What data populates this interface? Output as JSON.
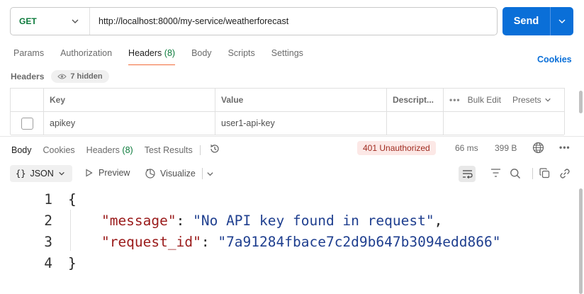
{
  "request": {
    "method": "GET",
    "url": "http://localhost:8000/my-service/weatherforecast",
    "send_label": "Send"
  },
  "request_tabs": [
    {
      "label": "Params",
      "count": ""
    },
    {
      "label": "Authorization",
      "count": ""
    },
    {
      "label": "Headers",
      "count": "(8)"
    },
    {
      "label": "Body",
      "count": ""
    },
    {
      "label": "Scripts",
      "count": ""
    },
    {
      "label": "Settings",
      "count": ""
    }
  ],
  "active_request_tab": "Headers",
  "cookies_link": "Cookies",
  "headers_section": {
    "title": "Headers",
    "hidden_label": "7 hidden"
  },
  "headers_table": {
    "columns": {
      "key": "Key",
      "value": "Value",
      "description": "Descript...",
      "bulk_edit": "Bulk Edit",
      "presets": "Presets"
    },
    "rows": [
      {
        "key": "apikey",
        "value": "user1-api-key",
        "description": ""
      }
    ]
  },
  "response": {
    "tabs": [
      {
        "label": "Body",
        "count": ""
      },
      {
        "label": "Cookies",
        "count": ""
      },
      {
        "label": "Headers",
        "count": "(8)"
      },
      {
        "label": "Test Results",
        "count": ""
      }
    ],
    "status": "401 Unauthorized",
    "time": "66 ms",
    "size": "399 B",
    "format": "JSON",
    "preview_label": "Preview",
    "visualize_label": "Visualize",
    "body_lines": [
      {
        "n": "1",
        "parts": [
          {
            "t": "punc",
            "v": "{"
          }
        ]
      },
      {
        "n": "2",
        "parts": [
          {
            "t": "key",
            "v": "    \"message\""
          },
          {
            "t": "punc",
            "v": ": "
          },
          {
            "t": "str",
            "v": "\"No API key found in request\""
          },
          {
            "t": "punc",
            "v": ","
          }
        ]
      },
      {
        "n": "3",
        "parts": [
          {
            "t": "key",
            "v": "    \"request_id\""
          },
          {
            "t": "punc",
            "v": ": "
          },
          {
            "t": "str",
            "v": "\"7a91284fbace7c2d9b647b3094edd866\""
          }
        ]
      },
      {
        "n": "4",
        "parts": [
          {
            "t": "punc",
            "v": "}"
          }
        ]
      }
    ]
  },
  "colors": {
    "send": "#0a6fd8",
    "method_get": "#0b7a3b",
    "status_bg": "#fce8e6",
    "status_text": "#9f2a1f",
    "json_key": "#9a1b1b",
    "json_string": "#1f3f8f"
  }
}
